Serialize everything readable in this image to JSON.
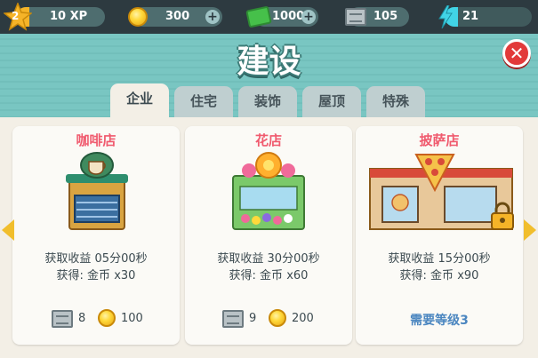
{
  "status": {
    "level": "2",
    "xp_label": "10 XP",
    "xp_fill": 0.15,
    "coins": "300",
    "cash": "1000",
    "bricks": "105",
    "energy": "21",
    "energy_fill": 0.15,
    "plus_glyph": "+"
  },
  "title": "建设",
  "close_glyph": "✕",
  "tabs": [
    {
      "label": "企业",
      "active": true
    },
    {
      "label": "住宅",
      "active": false
    },
    {
      "label": "装饰",
      "active": false
    },
    {
      "label": "屋顶",
      "active": false
    },
    {
      "label": "特殊",
      "active": false
    }
  ],
  "cards": [
    {
      "name": "咖啡店",
      "income_line": "获取收益 05分00秒",
      "reward_line": "获得: 金币 x30",
      "bricks_cost": "8",
      "coin_cost": "100",
      "locked": false
    },
    {
      "name": "花店",
      "income_line": "获取收益 30分00秒",
      "reward_line": "获得: 金币 x60",
      "bricks_cost": "9",
      "coin_cost": "200",
      "locked": false
    },
    {
      "name": "披萨店",
      "income_line": "获取收益 15分00秒",
      "reward_line": "获得: 金币 x90",
      "need_level": "需要等级3",
      "locked": true
    }
  ],
  "colors": {
    "accent_title": "#f05a6e",
    "level_required": "#4b86c0",
    "topbar": "#2d3a40"
  }
}
